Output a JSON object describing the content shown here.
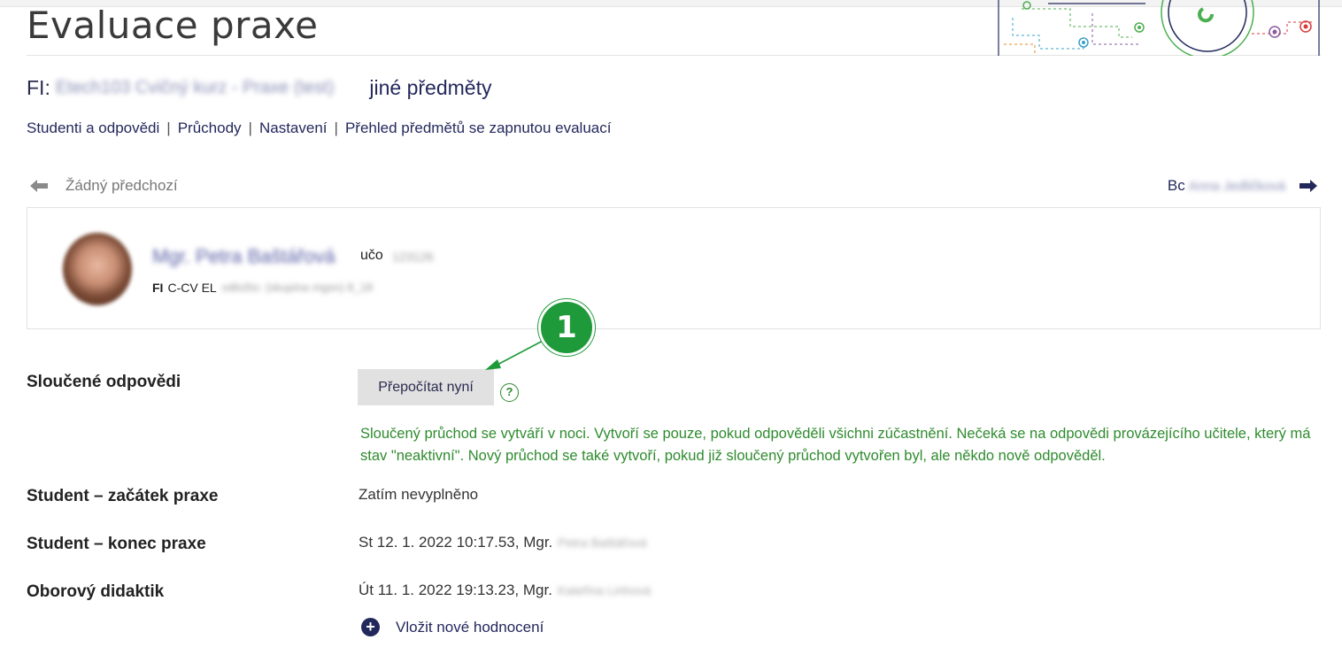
{
  "header": {
    "page_title": "Evaluace praxe"
  },
  "course": {
    "prefix": "FI:",
    "name": "Etech103 Cvičný kurz - Praxe (test)",
    "other_subjects": "jiné předměty"
  },
  "nav": {
    "items": [
      {
        "label": "Studenti a odpovědi"
      },
      {
        "label": "Průchody"
      },
      {
        "label": "Nastavení"
      },
      {
        "label": "Přehled předmětů se zapnutou evaluací"
      }
    ],
    "separator": "|"
  },
  "pager": {
    "prev_label": "Žádný předchozí",
    "next_prefix": "Bc",
    "next_name": "Anna Jedličková"
  },
  "person": {
    "name": "Mgr. Petra Baštářová",
    "uco_label": "učo",
    "uco_value": "123126",
    "study_faculty": "FI",
    "study_program": "C-CV EL",
    "study_rest": "odložto: (skupina mgsn) 8_18"
  },
  "merged": {
    "label": "Sloučené odpovědi",
    "button_label": "Přepočítat nyní",
    "help_glyph": "?",
    "info": "Sloučený průchod se vytváří v noci. Vytvoří se pouze, pokud odpověděli všichni zúčastnění. Nečeká se na odpovědi provázejícího učitele, který má stav \"neaktivní\". Nový průchod se také vytvoří, pokud již sloučený průchod vytvořen byl, ale někdo nově odpověděl."
  },
  "rows": [
    {
      "label": "Student – začátek praxe",
      "value": "Zatím nevyplněno",
      "blurred": ""
    },
    {
      "label": "Student – konec praxe",
      "value": "St 12. 1. 2022 10:17.53, Mgr.",
      "blurred": "Petra Baštářová"
    },
    {
      "label": "Oborový didaktik",
      "value": "Út 11. 1. 2022 19:13.23, Mgr.",
      "blurred": "Kateřina Linhová"
    }
  ],
  "add_rating": {
    "label": "Vložit nové hodnocení",
    "icon": "plus-circle-icon"
  },
  "callout": {
    "number": "1",
    "color": "#1f9a3a"
  },
  "colors": {
    "link": "#23285c",
    "info_green": "#2e8b2e",
    "button_bg": "#e1e1e1"
  }
}
